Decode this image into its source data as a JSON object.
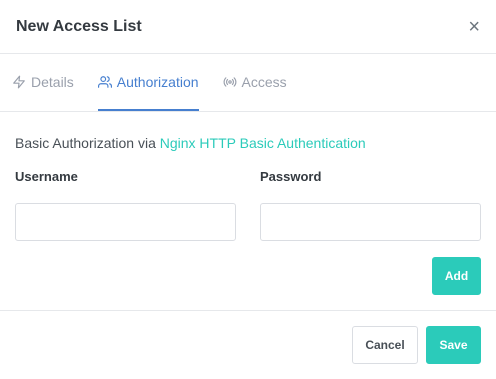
{
  "modal": {
    "title": "New Access List",
    "close_glyph": "×"
  },
  "tabs": [
    {
      "label": "Details",
      "icon": "bolt-icon",
      "active": false
    },
    {
      "label": "Authorization",
      "icon": "users-icon",
      "active": true
    },
    {
      "label": "Access",
      "icon": "signal-icon",
      "active": false
    }
  ],
  "auth": {
    "intro_prefix": "Basic Authorization via ",
    "intro_link": "Nginx HTTP Basic Authentication",
    "username_label": "Username",
    "password_label": "Password",
    "username_value": "",
    "password_value": "",
    "add_label": "Add"
  },
  "footer": {
    "cancel_label": "Cancel",
    "save_label": "Save"
  },
  "colors": {
    "accent_blue": "#467fcf",
    "accent_teal": "#2bcbba"
  }
}
